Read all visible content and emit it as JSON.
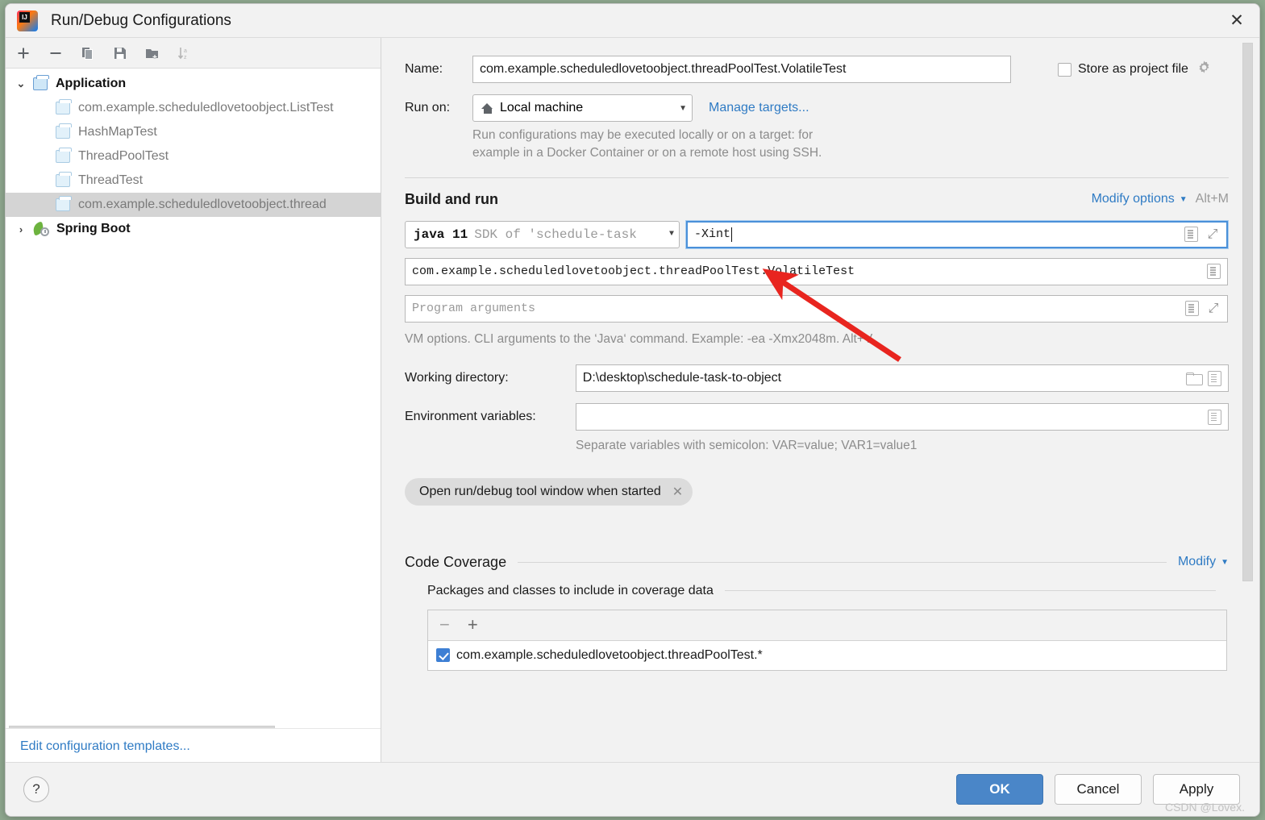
{
  "window": {
    "title": "Run/Debug Configurations",
    "app_icon": "intellij-idea-logo",
    "close_icon": "✕"
  },
  "tree_toolbar": {
    "icons": [
      {
        "name": "add-configuration-icon",
        "glyph": "+"
      },
      {
        "name": "remove-configuration-icon",
        "glyph": "−"
      },
      {
        "name": "copy-configuration-icon",
        "glyph": "⧉"
      },
      {
        "name": "save-configuration-icon",
        "glyph": "💾"
      },
      {
        "name": "move-to-folder-icon",
        "glyph": "📁"
      },
      {
        "name": "sort-alphabetically-icon",
        "glyph": "↓"
      }
    ]
  },
  "sidebar": {
    "groups": [
      {
        "label": "Application",
        "expanded": true,
        "twisty": "⌄",
        "children": [
          {
            "label": "com.example.scheduledlovetoobject.ListTest",
            "selected": false
          },
          {
            "label": "HashMapTest",
            "selected": false
          },
          {
            "label": "ThreadPoolTest",
            "selected": false
          },
          {
            "label": "ThreadTest",
            "selected": false
          },
          {
            "label": "com.example.scheduledlovetoobject.thread",
            "selected": true
          }
        ]
      },
      {
        "label": "Spring Boot",
        "expanded": false,
        "twisty": "›",
        "children": []
      }
    ],
    "edit_templates_link": "Edit configuration templates..."
  },
  "form": {
    "name_label": "Name:",
    "name_value": "com.example.scheduledlovetoobject.threadPoolTest.VolatileTest",
    "store_as_project_file_label": "Store as project file",
    "store_as_project_file_checked": false,
    "gear_icon": "gear-icon",
    "run_on_label": "Run on:",
    "run_on_value": "Local machine",
    "manage_targets_link": "Manage targets...",
    "run_on_hint_line1": "Run configurations may be executed locally or on a target: for",
    "run_on_hint_line2": "example in a Docker Container or on a remote host using SSH."
  },
  "build_and_run": {
    "section_title": "Build and run",
    "modify_options_link": "Modify options",
    "modify_options_shortcut": "Alt+M",
    "jdk_name": "java 11",
    "jdk_detail": "SDK of 'schedule-task",
    "vm_options_value": "-Xint",
    "main_class_value": "com.example.scheduledlovetoobject.threadPoolTest.VolatileTest",
    "program_arguments_placeholder": "Program arguments",
    "vm_options_hint": "VM options. CLI arguments to the ‘Java‘ command. Example: -ea -Xmx2048m. Alt+V",
    "working_directory_label": "Working directory:",
    "working_directory_value": "D:\\desktop\\schedule-task-to-object",
    "environment_variables_label": "Environment variables:",
    "environment_variables_value": "",
    "environment_variables_hint": "Separate variables with semicolon: VAR=value; VAR1=value1",
    "option_chip_label": "Open run/debug tool window when started",
    "option_chip_remove": "✕"
  },
  "code_coverage": {
    "section_title": "Code Coverage",
    "modify_link": "Modify",
    "packages_title": "Packages and classes to include in coverage data",
    "toolbar": [
      {
        "name": "remove-package-icon",
        "glyph": "−"
      },
      {
        "name": "add-package-icon",
        "glyph": "+"
      }
    ],
    "rows": [
      {
        "label": "com.example.scheduledlovetoobject.threadPoolTest.*",
        "checked": true
      }
    ]
  },
  "footer": {
    "help_label": "?",
    "ok_label": "OK",
    "cancel_label": "Cancel",
    "apply_label": "Apply"
  },
  "watermark": "CSDN @Lovex.",
  "colors": {
    "accent_blue": "#4a86c8",
    "link_blue": "#2f7bc4",
    "focus_border": "#4a90d9",
    "annotation_red": "#e8251f",
    "selection_gray": "#d4d4d4"
  }
}
